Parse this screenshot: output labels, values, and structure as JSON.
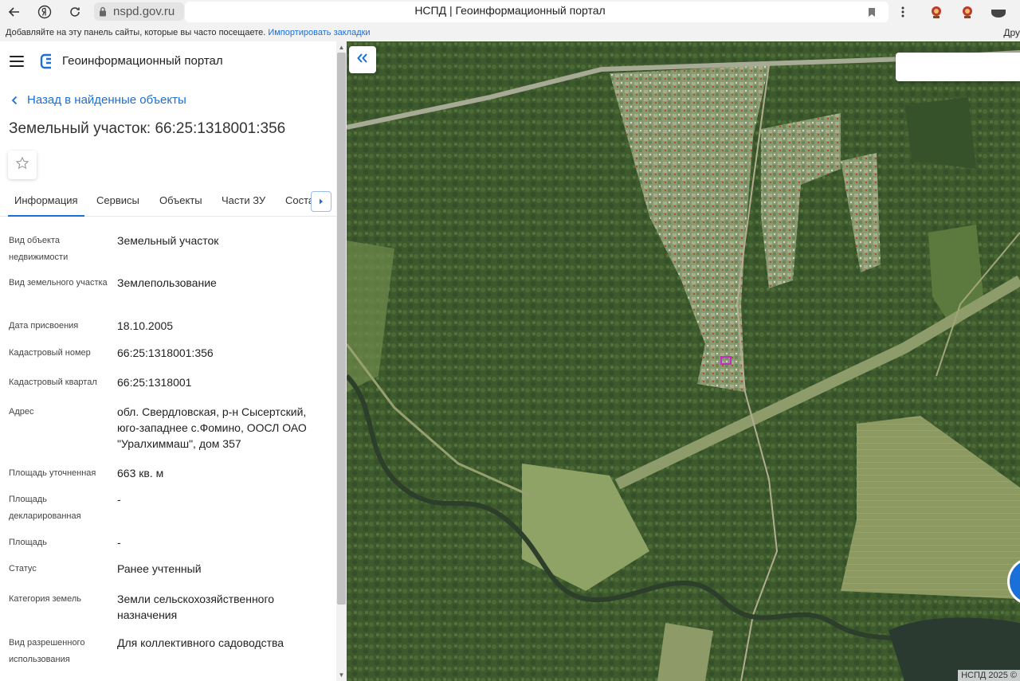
{
  "browser": {
    "url": "nspd.gov.ru",
    "tab_title": "НСПД | Геоинформационный портал",
    "bookmarks_hint": "Добавляйте на эту панель сайты, которые вы часто посещаете.",
    "bookmarks_import": "Импортировать закладки",
    "bookmarks_other": "Дру"
  },
  "portal": {
    "title": "Геоинформационный портал",
    "back_link": "Назад в найденные объекты",
    "object_title": "Земельный участок: 66:25:1318001:356"
  },
  "tabs": [
    {
      "label": "Информация",
      "active": true
    },
    {
      "label": "Сервисы",
      "active": false
    },
    {
      "label": "Объекты",
      "active": false
    },
    {
      "label": "Части ЗУ",
      "active": false
    },
    {
      "label": "Соста",
      "active": false
    }
  ],
  "properties": [
    {
      "label": "Вид объекта недвижимости",
      "value": "Земельный участок"
    },
    {
      "label": "Вид земельного участка",
      "value": "Землепользование"
    },
    {
      "label": "Дата присвоения",
      "value": "18.10.2005"
    },
    {
      "label": "Кадастровый номер",
      "value": "66:25:1318001:356"
    },
    {
      "label": "Кадастровый квартал",
      "value": "66:25:1318001"
    },
    {
      "label": "Адрес",
      "value": "обл. Свердловская, р-н Сысертский, юго-западнее с.Фомино, ООСЛ ОАО \"Уралхиммаш\", дом 357"
    },
    {
      "label": "Площадь уточненная",
      "value": "663 кв. м"
    },
    {
      "label": "Площадь декларированная",
      "value": "-"
    },
    {
      "label": "Площадь",
      "value": "-"
    },
    {
      "label": "Статус",
      "value": "Ранее учтенный"
    },
    {
      "label": "Категория земель",
      "value": "Земли сельскохозяйственного назначения"
    },
    {
      "label": "Вид разрешенного использования",
      "value": "Для коллективного садоводства"
    }
  ],
  "map": {
    "copyright": "НСПД 2025 ©"
  },
  "colors": {
    "accent": "#1a6fd8",
    "parcel_highlight": "#c030c8"
  }
}
